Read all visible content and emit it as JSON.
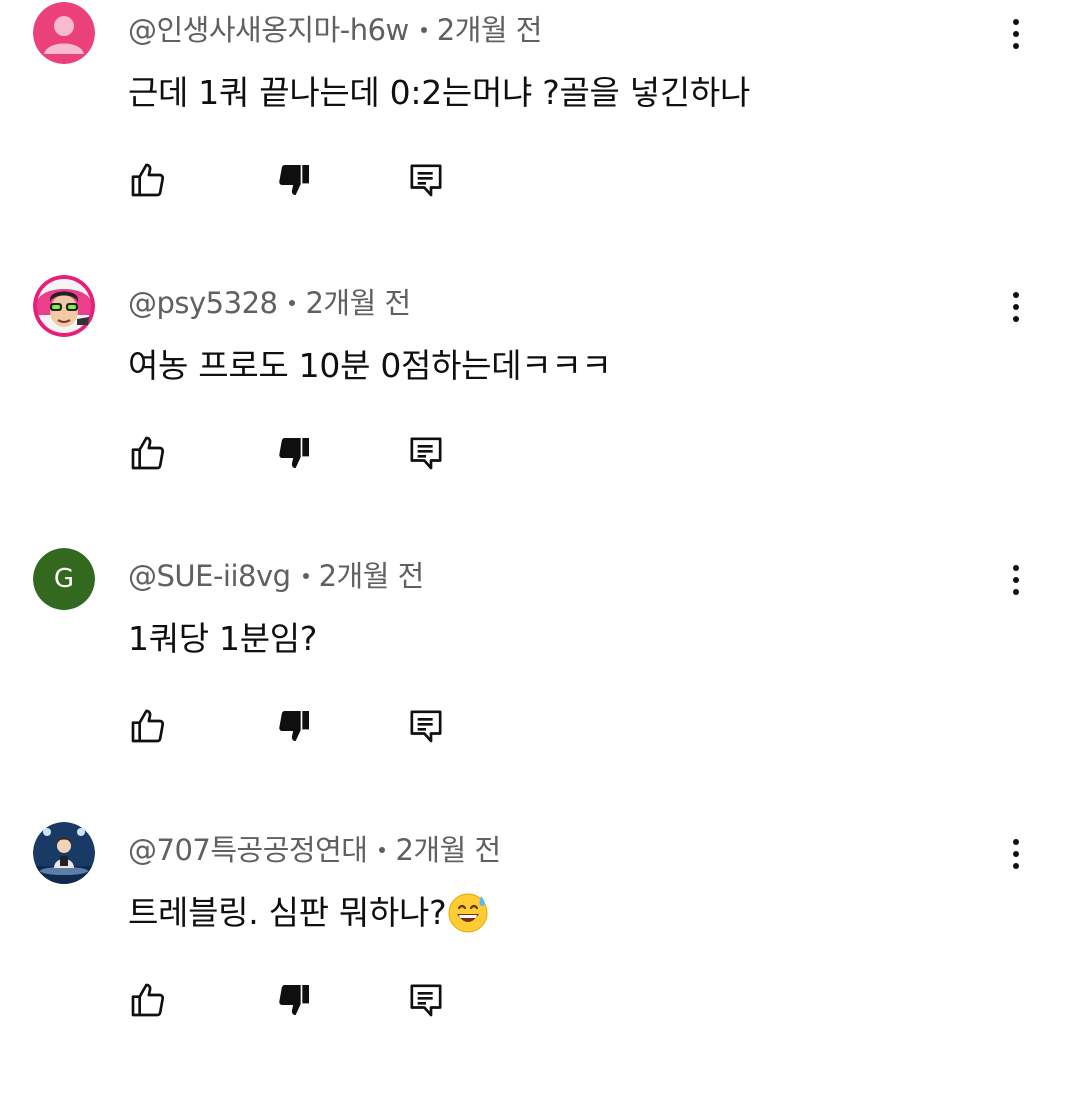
{
  "comments": [
    {
      "author": "@인생사새옹지마-h6w",
      "time": "2개월 전",
      "text": "근데 1쿼 끝나는데 0:2는머냐 ?골을 넣긴하나",
      "avatar": {
        "type": "default-person",
        "bg": "#ec407a",
        "fg": "#f8bbd0"
      }
    },
    {
      "author": "@psy5328",
      "time": "2개월 전",
      "text": "여농 프로도 10분 0점하는데ㅋㅋㅋ",
      "avatar": {
        "type": "photo",
        "description_icon": "person-with-sunglasses-icon"
      }
    },
    {
      "author": "@SUE-ii8vg",
      "time": "2개월 전",
      "text": "1쿼당 1분임?",
      "avatar": {
        "type": "letter",
        "letter": "G",
        "bg": "#33691e"
      }
    },
    {
      "author": "@707특공공정연대",
      "time": "2개월 전",
      "text": "트레블링. 심판 뭐하나?",
      "emoji": "grinning-face-with-sweat-icon",
      "avatar": {
        "type": "photo",
        "description_icon": "person-on-stage-icon"
      }
    }
  ],
  "icons": {
    "like": "thumbs-up-icon",
    "dislike": "thumbs-down-icon",
    "reply": "reply-comment-icon",
    "more": "more-vertical-icon"
  },
  "colors": {
    "text": "#0f0f0f",
    "meta": "#606060",
    "background": "#ffffff"
  }
}
